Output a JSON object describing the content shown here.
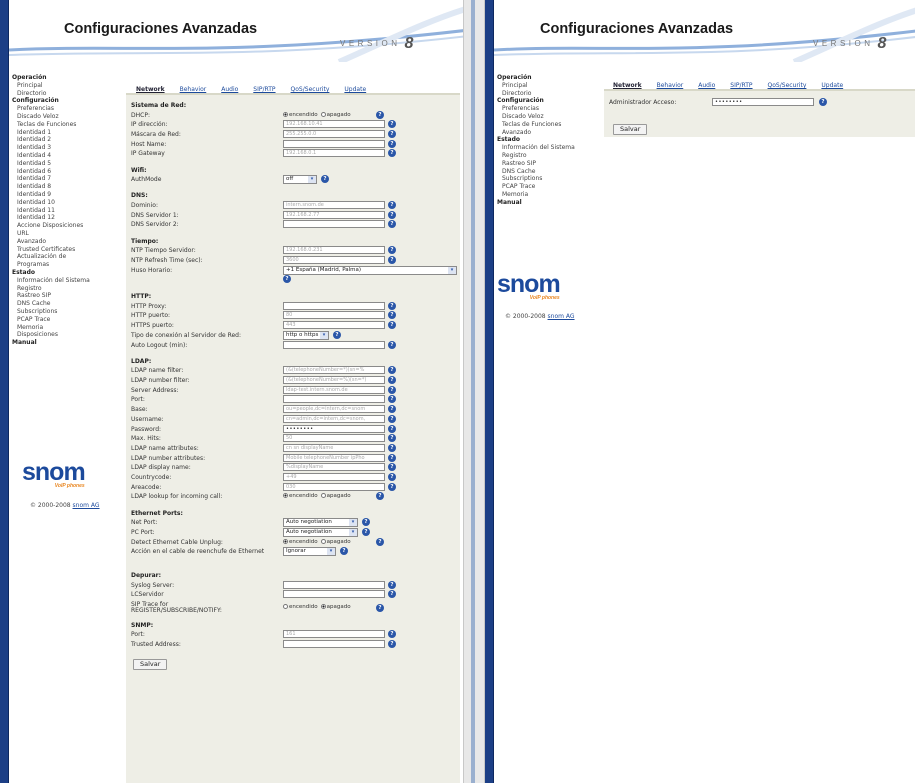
{
  "app": {
    "title": "Configuraciones Avanzadas",
    "version_word": "VERSION",
    "version_num": "8"
  },
  "menu_left": [
    {
      "t": "h",
      "l": "Operación"
    },
    {
      "t": "i",
      "l": "Principal"
    },
    {
      "t": "i",
      "l": "Directorio"
    },
    {
      "t": "h",
      "l": "Configuración"
    },
    {
      "t": "i",
      "l": "Preferencias"
    },
    {
      "t": "i",
      "l": "Discado Veloz"
    },
    {
      "t": "i",
      "l": "Teclas de Funciones"
    },
    {
      "t": "i",
      "l": "Identidad 1"
    },
    {
      "t": "i",
      "l": "Identidad 2"
    },
    {
      "t": "i",
      "l": "Identidad 3"
    },
    {
      "t": "i",
      "l": "Identidad 4"
    },
    {
      "t": "i",
      "l": "Identidad 5"
    },
    {
      "t": "i",
      "l": "Identidad 6"
    },
    {
      "t": "i",
      "l": "Identidad 7"
    },
    {
      "t": "i",
      "l": "Identidad 8"
    },
    {
      "t": "i",
      "l": "Identidad 9"
    },
    {
      "t": "i",
      "l": "Identidad 10"
    },
    {
      "t": "i",
      "l": "Identidad 11"
    },
    {
      "t": "i",
      "l": "Identidad 12"
    },
    {
      "t": "i",
      "l": "Accione Disposiciones"
    },
    {
      "t": "i",
      "l": "URL"
    },
    {
      "t": "i",
      "l": "Avanzado"
    },
    {
      "t": "i",
      "l": "Trusted Certificates"
    },
    {
      "t": "i",
      "l": "Actualización de"
    },
    {
      "t": "i",
      "l": "Programas"
    },
    {
      "t": "h",
      "l": "Estado"
    },
    {
      "t": "i",
      "l": "Información del Sistema"
    },
    {
      "t": "i",
      "l": "Registro"
    },
    {
      "t": "i",
      "l": "Rastreo SIP"
    },
    {
      "t": "i",
      "l": "DNS Cache"
    },
    {
      "t": "i",
      "l": "Subscriptions"
    },
    {
      "t": "i",
      "l": "PCAP Trace"
    },
    {
      "t": "i",
      "l": "Memoria"
    },
    {
      "t": "i",
      "l": "Disposiciones"
    },
    {
      "t": "h",
      "l": "Manual"
    }
  ],
  "menu_right": [
    {
      "t": "h",
      "l": "Operación"
    },
    {
      "t": "i",
      "l": "Principal"
    },
    {
      "t": "i",
      "l": "Directorio"
    },
    {
      "t": "h",
      "l": "Configuración"
    },
    {
      "t": "i",
      "l": "Preferencias"
    },
    {
      "t": "i",
      "l": "Discado Veloz"
    },
    {
      "t": "i",
      "l": "Teclas de Funciones"
    },
    {
      "t": "i",
      "l": "Avanzado"
    },
    {
      "t": "h",
      "l": "Estado"
    },
    {
      "t": "i",
      "l": "Información del Sistema"
    },
    {
      "t": "i",
      "l": "Registro"
    },
    {
      "t": "i",
      "l": "Rastreo SIP"
    },
    {
      "t": "i",
      "l": "DNS Cache"
    },
    {
      "t": "i",
      "l": "Subscriptions"
    },
    {
      "t": "i",
      "l": "PCAP Trace"
    },
    {
      "t": "i",
      "l": "Memoria"
    },
    {
      "t": "h",
      "l": "Manual"
    }
  ],
  "logo": {
    "word": "snom",
    "tagline": "VoIP phones",
    "copyright": "© 2000-2008 ",
    "company_link": "snom AG"
  },
  "tabs": [
    "Network",
    "Behavior",
    "Audio",
    "SIP/RTP",
    "QoS/Security",
    "Update"
  ],
  "radio": {
    "on": "encendido",
    "off": "apagado"
  },
  "help": "?",
  "form": [
    {
      "k": "sec",
      "l": "Sistema de Red:"
    },
    {
      "k": "radio",
      "l": "DHCP:",
      "v": "on"
    },
    {
      "k": "text",
      "l": "IP dirección:",
      "v": "192.168.10.41"
    },
    {
      "k": "text",
      "l": "Máscara de Red:",
      "v": "255.255.0.0"
    },
    {
      "k": "text",
      "l": "Host Name:",
      "v": ""
    },
    {
      "k": "text",
      "l": "IP Gateway",
      "v": "192.168.0.1"
    },
    {
      "k": "gap"
    },
    {
      "k": "sec",
      "l": "Wifi:"
    },
    {
      "k": "select",
      "l": "AuthMode",
      "v": "off",
      "w": 24
    },
    {
      "k": "gap"
    },
    {
      "k": "sec",
      "l": "DNS:"
    },
    {
      "k": "text",
      "l": "Dominio:",
      "v": "intern.snom.de"
    },
    {
      "k": "text",
      "l": "DNS Servidor 1:",
      "v": "192.168.2.77"
    },
    {
      "k": "text",
      "l": "DNS Servidor 2:",
      "v": ""
    },
    {
      "k": "gap"
    },
    {
      "k": "sec",
      "l": "Tiempo:"
    },
    {
      "k": "text",
      "l": "NTP Tiempo Servidor:",
      "v": "192.168.0.231"
    },
    {
      "k": "text",
      "l": "NTP Refresh Time (sec):",
      "v": "3600"
    },
    {
      "k": "select",
      "l": "Huso Horario:",
      "v": "+1 España (Madrid, Palma)",
      "w": 164,
      "tall": true
    },
    {
      "k": "gap"
    },
    {
      "k": "sec",
      "l": "HTTP:"
    },
    {
      "k": "text",
      "l": "HTTP Proxy:",
      "v": ""
    },
    {
      "k": "text",
      "l": "HTTP puerto:",
      "v": "80"
    },
    {
      "k": "text",
      "l": "HTTPS puerto:",
      "v": "443"
    },
    {
      "k": "select",
      "l": "Tipo de conexión al Servidor de Red:",
      "v": "http o https",
      "w": 36
    },
    {
      "k": "text",
      "l": "Auto Logout (min):",
      "v": ""
    },
    {
      "k": "gap"
    },
    {
      "k": "sec",
      "l": "LDAP:"
    },
    {
      "k": "text",
      "l": "LDAP name filter:",
      "v": "(&(telephoneNumber=*)(sn=%"
    },
    {
      "k": "text",
      "l": "LDAP number filter:",
      "v": "(&(telephoneNumber=%)(sn=*)"
    },
    {
      "k": "text",
      "l": "Server Address:",
      "v": "ldap-test.intern.snom.de"
    },
    {
      "k": "text",
      "l": "Port:",
      "v": ""
    },
    {
      "k": "text",
      "l": "Base:",
      "v": "ou=people,dc=intern,dc=snom"
    },
    {
      "k": "text",
      "l": "Username:",
      "v": "cn=admin,dc=intern,dc=snom,"
    },
    {
      "k": "pw",
      "l": "Password:",
      "v": "••••••••"
    },
    {
      "k": "text",
      "l": "Max. Hits:",
      "v": "50"
    },
    {
      "k": "text",
      "l": "LDAP name attributes:",
      "v": "cn sn displayName"
    },
    {
      "k": "text",
      "l": "LDAP number attributes:",
      "v": "Mobile telephoneNumber ipPho"
    },
    {
      "k": "text",
      "l": "LDAP display name:",
      "v": "%displayName"
    },
    {
      "k": "text",
      "l": "Countrycode:",
      "v": "+49"
    },
    {
      "k": "text",
      "l": "Areacode:",
      "v": "030"
    },
    {
      "k": "radio",
      "l": "LDAP lookup for incoming call:",
      "v": "on"
    },
    {
      "k": "gap"
    },
    {
      "k": "sec",
      "l": "Ethernet Ports:"
    },
    {
      "k": "select",
      "l": "Net Port:",
      "v": "Auto negotiation",
      "w": 65
    },
    {
      "k": "select",
      "l": "PC Port:",
      "v": "Auto negotiation",
      "w": 65
    },
    {
      "k": "radio",
      "l": "Detect Ethernet Cable Unplug:",
      "v": "on"
    },
    {
      "k": "select",
      "l": "Acción en el cable de reenchufe de Ethernet",
      "v": "Ignorar",
      "w": 43
    },
    {
      "k": "gap"
    },
    {
      "k": "gap"
    },
    {
      "k": "sec",
      "l": "Depurar:"
    },
    {
      "k": "text",
      "l": "Syslog Server:",
      "v": ""
    },
    {
      "k": "text",
      "l": "LCServidor",
      "v": ""
    },
    {
      "k": "radio2",
      "l": "SIP Trace for",
      "l2": "REGISTER/SUBSCRIBE/NOTIFY:",
      "v": "off"
    },
    {
      "k": "gap"
    },
    {
      "k": "sec",
      "l": "SNMP:"
    },
    {
      "k": "text",
      "l": "Port:",
      "v": "161"
    },
    {
      "k": "text",
      "l": "Trusted Address:",
      "v": ""
    }
  ],
  "save_label": "Salvar",
  "right_form": {
    "label": "Administrador Acceso:",
    "value": "••••••••"
  }
}
